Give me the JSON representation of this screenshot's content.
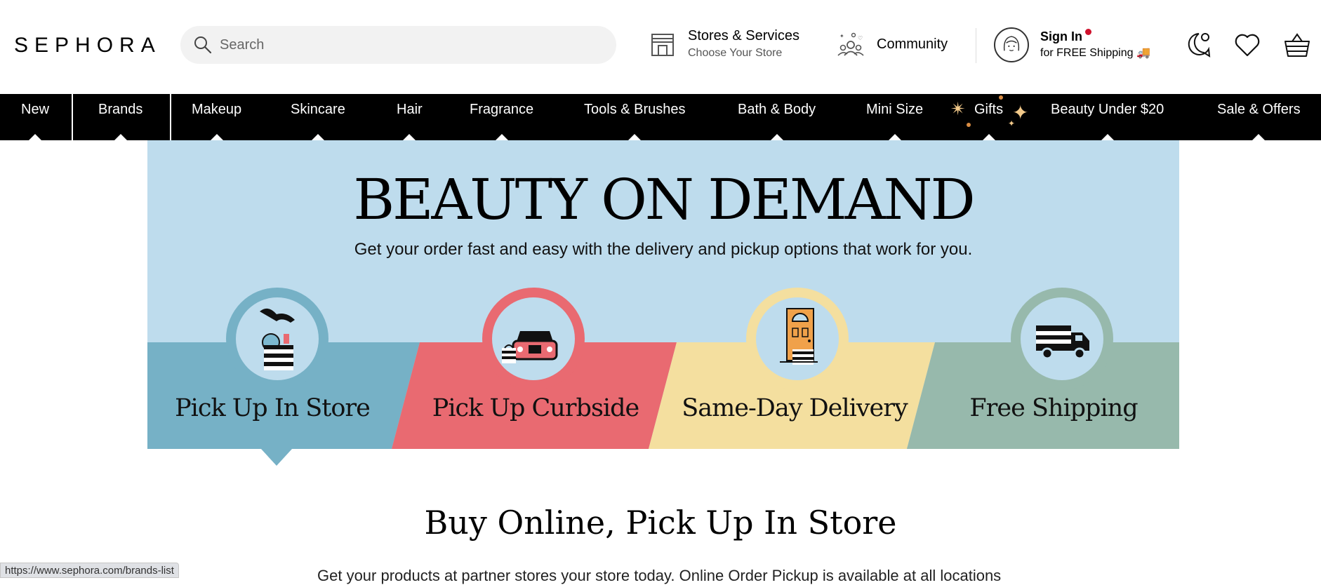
{
  "header": {
    "logo": "SEPHORA",
    "search_placeholder": "Search",
    "stores_title": "Stores & Services",
    "stores_sub": "Choose Your Store",
    "community": "Community",
    "signin": "Sign In",
    "free_shipping": "for FREE Shipping 🚚"
  },
  "nav": {
    "items": [
      "New",
      "Brands",
      "Makeup",
      "Skincare",
      "Hair",
      "Fragrance",
      "Tools & Brushes",
      "Bath & Body",
      "Mini Size",
      "Gifts",
      "Beauty Under $20",
      "Sale & Offers"
    ]
  },
  "banner": {
    "title": "BEAUTY ON DEMAND",
    "subtitle": "Get your order fast and easy with the delivery and pickup options that work for you.",
    "cards": [
      {
        "label": "Pick Up In Store",
        "color": "#76b1c6"
      },
      {
        "label": "Pick Up Curbside",
        "color": "#e96a71"
      },
      {
        "label": "Same-Day Delivery",
        "color": "#f4df9f"
      },
      {
        "label": "Free Shipping",
        "color": "#97b9ac"
      }
    ]
  },
  "main": {
    "section_title": "Buy Online, Pick Up In Store",
    "body_text": "Get your products at partner stores your store today. Online Order Pickup is available at all locations"
  },
  "status_bar": {
    "url": "https://www.sephora.com/brands-list"
  }
}
